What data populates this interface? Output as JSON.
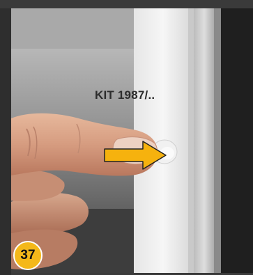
{
  "image": {
    "caption": "KIT 1987/..",
    "step_number": "37",
    "colors": {
      "badge_fill": "#f4b81a",
      "badge_outline": "#ffffff",
      "arrow_fill": "#f6b20e",
      "arrow_outline": "#222222"
    }
  }
}
